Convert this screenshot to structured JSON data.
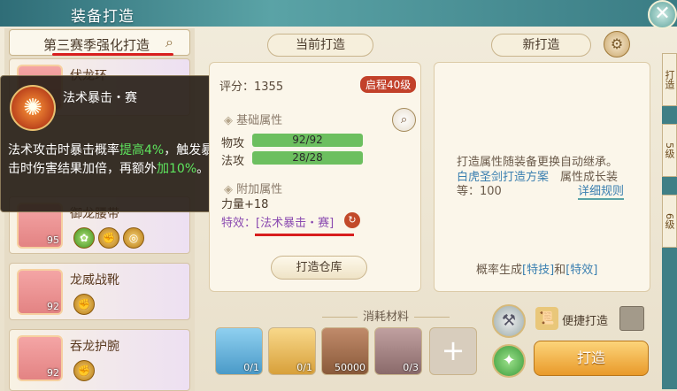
{
  "window": {
    "title": "装备打造",
    "close_glyph": "✕"
  },
  "search": {
    "value": "第三赛季强化打造"
  },
  "tabs": {
    "current": "当前打造",
    "new": "新打造"
  },
  "right_strip": {
    "tab1": "打造",
    "tab2": "5级",
    "tab3": "6级"
  },
  "items": [
    {
      "name": "伏龙环",
      "level": ""
    },
    {
      "name": "御龙腰带",
      "level": "95"
    },
    {
      "name": "龙威战靴",
      "level": "92"
    },
    {
      "name": "吞龙护腕",
      "level": "92"
    }
  ],
  "tooltip": {
    "title": "法术暴击・赛",
    "desc_a": "法术攻击时暴击概率",
    "desc_b": "提高4%",
    "desc_c": "，触发暴击时伤害结果加倍，再额外",
    "desc_d": "加10%",
    "desc_e": "。"
  },
  "current": {
    "score": "评分：1355",
    "badge": "启程40级",
    "base_header": "基础属性",
    "stats": [
      {
        "label": "物攻",
        "value": "92/92"
      },
      {
        "label": "法攻",
        "value": "28/28"
      }
    ],
    "extra_header": "附加属性",
    "extra_value": "力量+18",
    "special": "特效：[法术暴击・赛]",
    "warehouse": "打造仓库"
  },
  "new": {
    "info1": "打造属性随装备更换自动继承。",
    "info2_link": "白虎圣剑打造方案",
    "info2_rest": "属性成长装",
    "info3": "等：100",
    "rules_link": "详细规则",
    "prob_a": "概率生成",
    "prob_b": "[特技]",
    "prob_c": "和",
    "prob_d": "[特效]"
  },
  "materials": {
    "header": "消耗材料",
    "items": [
      {
        "count": "0/1"
      },
      {
        "count": "0/1"
      },
      {
        "count": "50000"
      },
      {
        "count": "0/3"
      }
    ]
  },
  "actions": {
    "quick": "便捷打造",
    "forge": "打造"
  }
}
